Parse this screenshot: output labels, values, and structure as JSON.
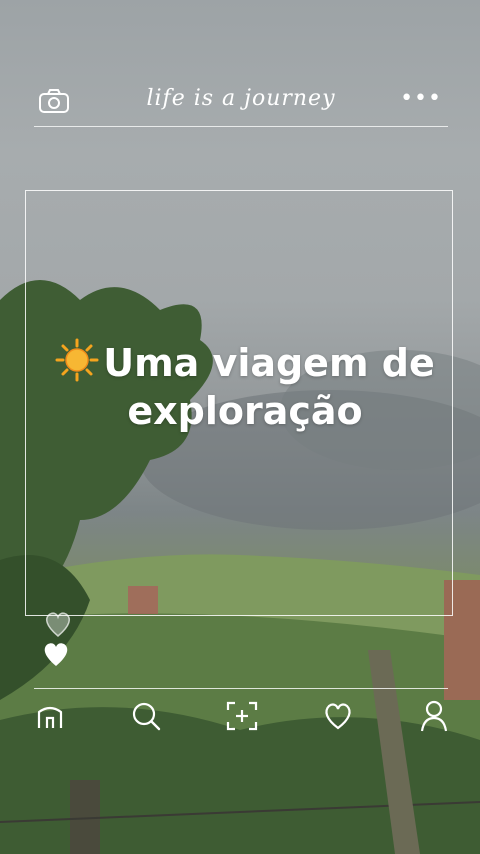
{
  "header": {
    "title": "life is a journey",
    "left_icon": "camera-icon",
    "right_icon": "more-dots-icon",
    "more_glyph": "•••"
  },
  "main": {
    "emoji": "sun-icon",
    "headline_line1": "Uma viagem de",
    "headline_line2": "exploração"
  },
  "reactions": {
    "icons": [
      "heart-outline-icon",
      "heart-filled-icon"
    ]
  },
  "bottom_nav": {
    "icons": [
      "home-icon",
      "search-icon",
      "scan-add-icon",
      "heart-icon",
      "profile-icon"
    ]
  },
  "colors": {
    "sky": "#a3a8aa",
    "foliage": "#4f6e3e",
    "sun": "#f5a41e",
    "overlay_line": "#ffffff"
  }
}
